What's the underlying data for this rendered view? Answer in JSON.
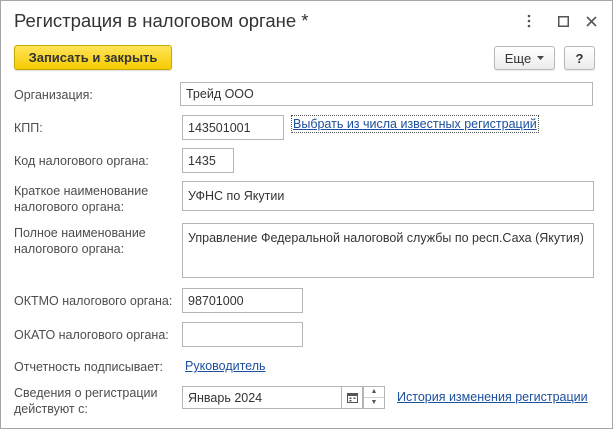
{
  "window": {
    "title": "Регистрация в налоговом органе *",
    "more_icon": "vertical-dots-icon",
    "maximize_icon": "square-icon",
    "close_icon": "close-icon"
  },
  "toolbar": {
    "save_close_label": "Записать и закрыть",
    "more_label": "Еще",
    "more_icon": "chevron-down-icon",
    "help_label": "?"
  },
  "form": {
    "organization": {
      "label": "Организация:",
      "value": "Трейд ООО"
    },
    "kpp": {
      "label": "КПП:",
      "value": "143501001",
      "link": "Выбрать из числа известных регистраций"
    },
    "tax_office_code": {
      "label": "Код налогового органа:",
      "value": "1435"
    },
    "short_name": {
      "label_1": "Краткое наименование",
      "label_2": "налогового органа:",
      "value": "УФНС по Якутии"
    },
    "full_name": {
      "label_1": "Полное наименование",
      "label_2": "налогового органа:",
      "value": "Управление Федеральной налоговой службы по респ.Саха (Якутия)"
    },
    "oktmo": {
      "label": "ОКТМО налогового органа:",
      "value": "98701000"
    },
    "okato": {
      "label": "ОКАТО налогового органа:",
      "value": ""
    },
    "signer": {
      "label": "Отчетность подписывает:",
      "link": "Руководитель"
    },
    "effective": {
      "label_1": "Сведения о регистрации",
      "label_2": "действуют с:",
      "value": "Январь 2024",
      "history_link": "История изменения регистрации"
    }
  },
  "colors": {
    "accent_yellow": "#f5cc00",
    "link": "#1c4f9c"
  }
}
